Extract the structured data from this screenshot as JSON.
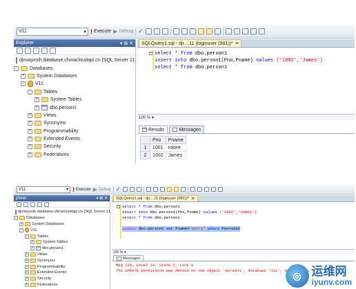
{
  "panel1": {
    "toolbar": {
      "database": "V11",
      "execute_label": "Execute",
      "debug_label": "Debug"
    },
    "explorer": {
      "title": "Explorer",
      "nodes": {
        "server": "djnxayxsih.database.chinacloudapi.cn (SQL Server 11.",
        "databases": "Databases",
        "system_databases": "System Databases",
        "v11": "V11",
        "tables": "Tables",
        "system_tables": "System Tables",
        "person1": "dbo.person1",
        "views": "Views",
        "synonyms": "Synonyms",
        "programmability": "Programmability",
        "extended_events": "Extended Events",
        "security": "Security",
        "federations": "Federations"
      }
    },
    "editor": {
      "tab_title": "SQLQuery1.sql - djr....11 (loginuser (981))*",
      "code": {
        "line1": {
          "kw1": "select",
          "star": " * ",
          "kw2": "from",
          "rest": " dbo.person1"
        },
        "line2": {
          "kw1": "insert into",
          "mid": " dbo.person1(Pno,Pname) ",
          "kw2": "values",
          "str": " ('1002','James')"
        },
        "line3": {
          "kw1": "select",
          "star": " * ",
          "kw2": "from",
          "rest": " dbo.person1"
        }
      },
      "zoom": "100 %",
      "results_tab": "Results",
      "messages_tab": "Messages",
      "grid": {
        "columns": [
          "Pno",
          "Pname"
        ],
        "rows": [
          {
            "num": "1",
            "pno": "1001",
            "pname": "robert"
          },
          {
            "num": "2",
            "pno": "1002",
            "pname": "James"
          }
        ]
      }
    }
  },
  "panel2": {
    "toolbar": {
      "database": "V11",
      "execute_label": "Execute",
      "debug_label": "Debug"
    },
    "explorer": {
      "title": "plorer",
      "nodes": {
        "server": "djnxayxsih.database.chinacloudapi.cn (SQL Server 11.",
        "databases": "Databases",
        "system_databases": "System Databases",
        "v11": "V11",
        "tables": "Tables",
        "system_tables": "System Tables",
        "person1": "dbo.person1",
        "views": "Views",
        "synonyms": "Synonyms",
        "programmability": "Programmability",
        "extended_events": "Extended Events",
        "security": "Security",
        "federations": "Federations"
      }
    },
    "editor": {
      "tab_title": "SQLQuery1.sql - djr....11 (loginuser (981))*",
      "code": {
        "line1": {
          "kw1": "select",
          "star": " * ",
          "kw2": "from",
          "rest": " dbo.person1"
        },
        "line2": {
          "kw1": "insert into",
          "mid": " dbo.person1(Pno,Pname) ",
          "kw2": "values",
          "str": " ('1002','James')"
        },
        "line3": {
          "kw1": "select",
          "star": " * ",
          "kw2": "from",
          "rest": " dbo.person1"
        },
        "line4": {
          "kw1": "update",
          "mid": " dbo.person1 ",
          "kw2": "set",
          "mid2": " Pname=",
          "str": "'terry'",
          "kw3": " where",
          "rest": " Pno=1002"
        }
      },
      "zoom": "100 %",
      "messages_tab": "Messages",
      "message_line1": "Msg 229, Level 14, State 5, Line 5",
      "message_line2": "The UPDATE permission was denied on the object 'person1', database 'V11', schema 'dbo'."
    }
  },
  "watermark": {
    "cn": "运维网",
    "en": "iyunv.com"
  }
}
